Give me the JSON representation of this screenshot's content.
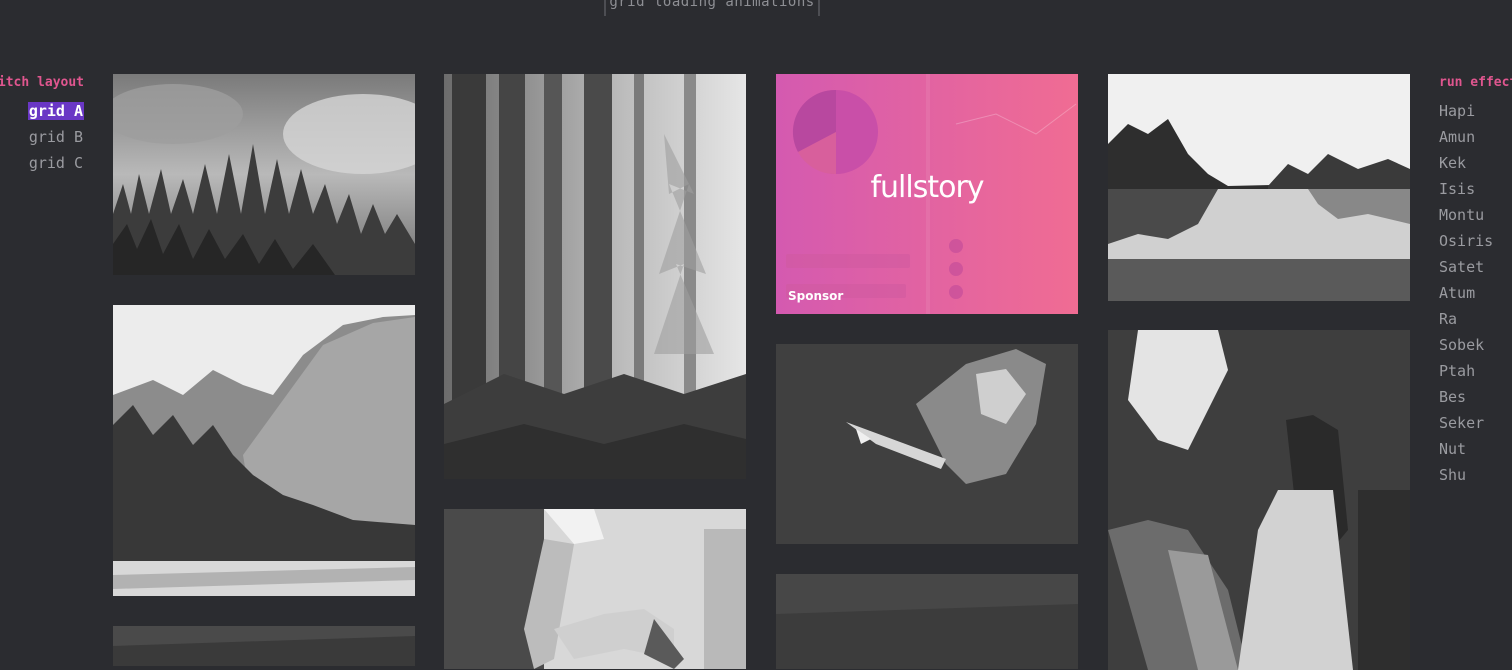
{
  "header": {
    "title": "grid loading animations"
  },
  "layout_menu": {
    "heading": "witch layout",
    "items": [
      {
        "label": "grid A",
        "active": true
      },
      {
        "label": "grid B",
        "active": false
      },
      {
        "label": "grid C",
        "active": false
      }
    ]
  },
  "effects_menu": {
    "heading": "run effect",
    "items": [
      "Hapi",
      "Amun",
      "Kek",
      "Isis",
      "Montu",
      "Osiris",
      "Satet",
      "Atum",
      "Ra",
      "Sobek",
      "Ptah",
      "Bes",
      "Seker",
      "Nut",
      "Shu"
    ]
  },
  "sponsor": {
    "logo": "fullstory",
    "label": "Sponsor"
  },
  "colors": {
    "accent": "#e0568f",
    "active_bg": "#6a37c5",
    "background": "#2b2c30",
    "sponsor": "#e8609c"
  }
}
